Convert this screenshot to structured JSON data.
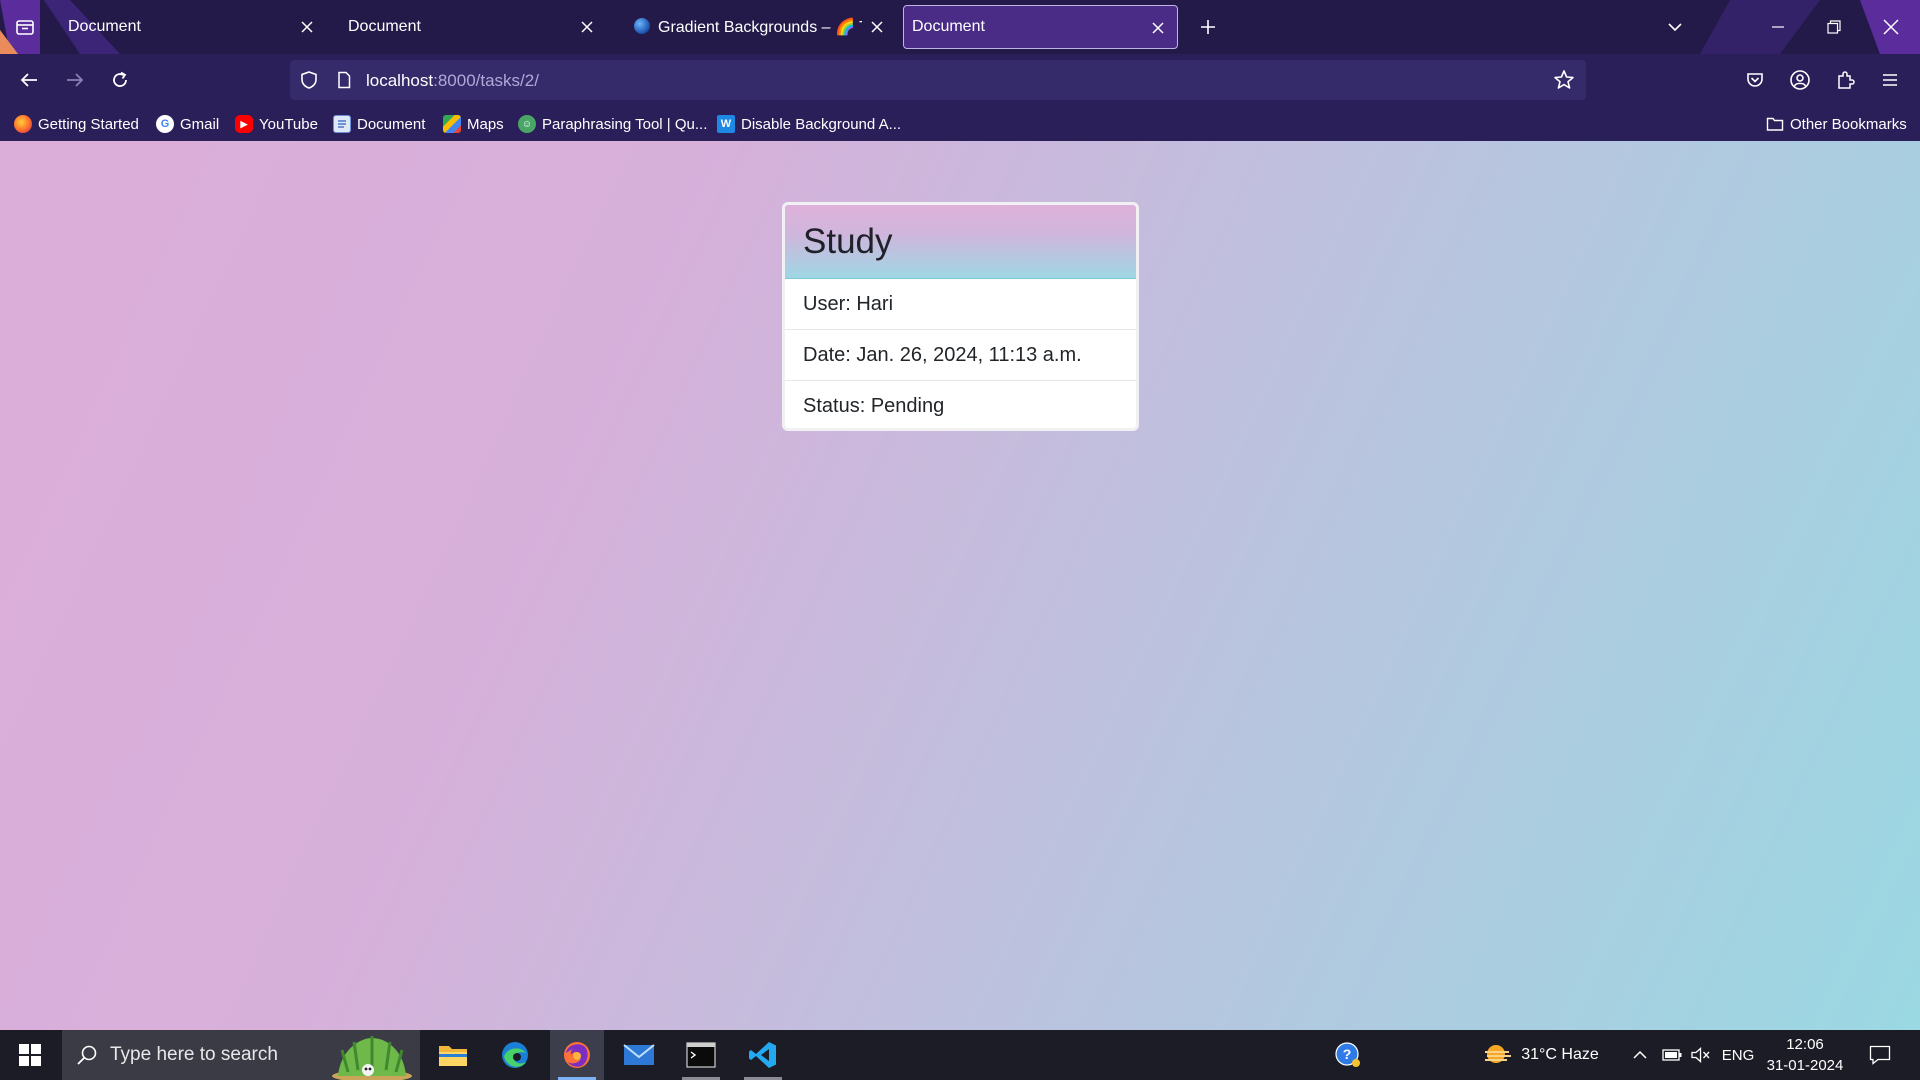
{
  "browser": {
    "tabs": [
      {
        "title": "Document",
        "active": false
      },
      {
        "title": "Document",
        "active": false
      },
      {
        "title": "Gradient Backgrounds – 🌈 The",
        "active": false
      },
      {
        "title": "Document",
        "active": true
      }
    ],
    "url": {
      "host": "localhost",
      "path": ":8000/tasks/2/"
    },
    "bookmarks": [
      {
        "label": "Getting Started",
        "icon": "firefox-icon"
      },
      {
        "label": "Gmail",
        "icon": "google-icon"
      },
      {
        "label": "YouTube",
        "icon": "youtube-icon"
      },
      {
        "label": "Document",
        "icon": "document-icon"
      },
      {
        "label": "Maps",
        "icon": "maps-icon"
      },
      {
        "label": "Paraphrasing Tool | Qu...",
        "icon": "quillbot-icon"
      },
      {
        "label": "Disable Background A...",
        "icon": "w-icon"
      }
    ],
    "other_bookmarks": "Other Bookmarks"
  },
  "task": {
    "title": "Study",
    "user": "User: Hari",
    "date": "Date: Jan. 26, 2024, 11:13 a.m.",
    "status": "Status: Pending"
  },
  "taskbar": {
    "search_placeholder": "Type here to search",
    "weather": "31°C  Haze",
    "language": "ENG",
    "time": "12:06",
    "date": "31-01-2024"
  },
  "colors": {
    "browser_chrome": "#231a4a",
    "active_tab": "#4a2b86",
    "page_gradient_start": "#dbaed9",
    "page_gradient_end": "#9ad8e2",
    "taskbar": "#1b1c25"
  }
}
